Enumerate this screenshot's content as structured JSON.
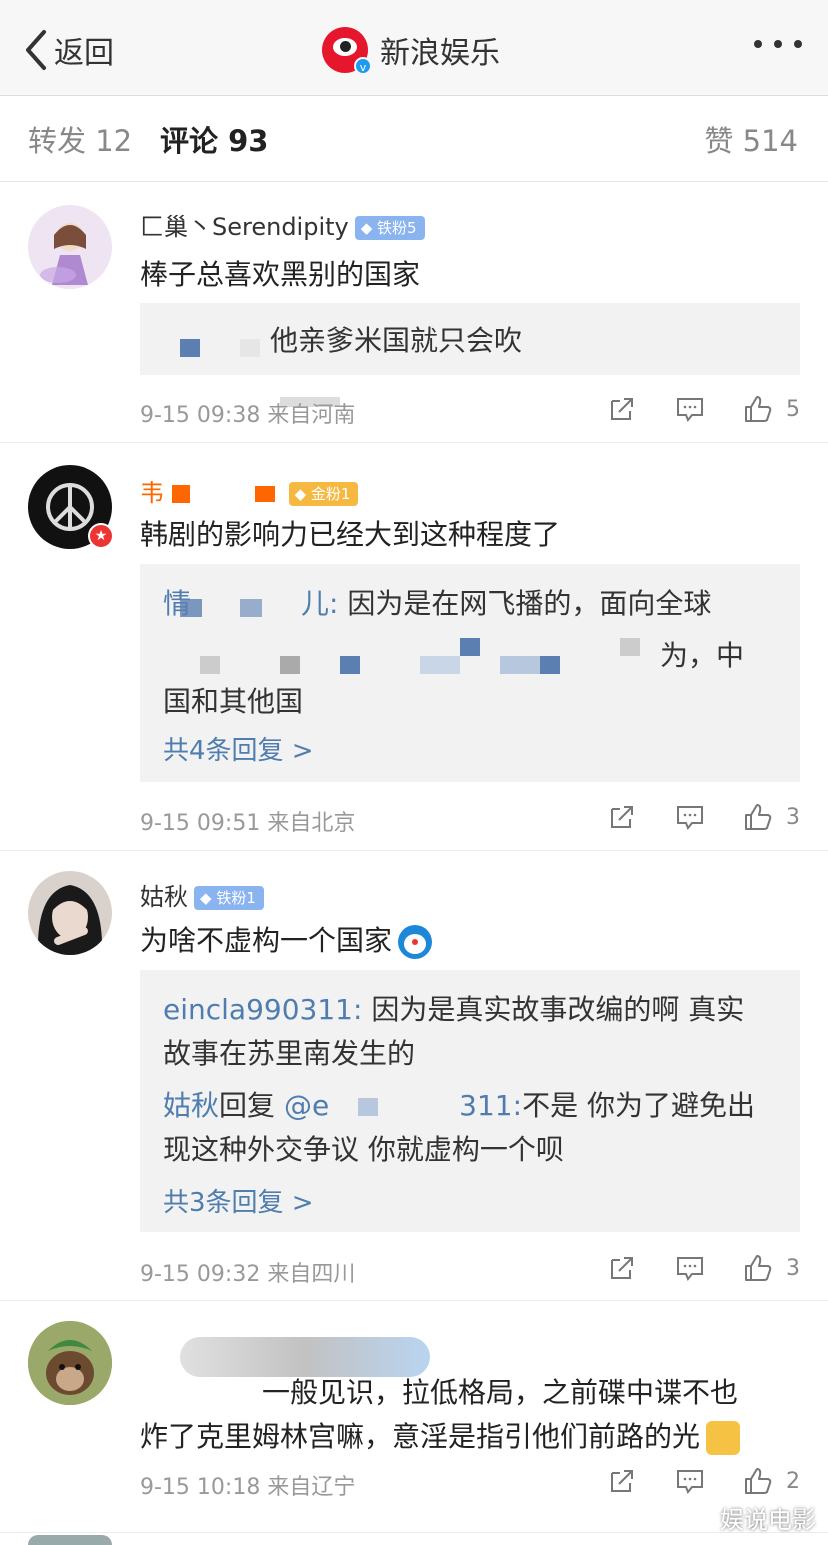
{
  "nav": {
    "back_label": "返回",
    "title": "新浪娱乐",
    "logo_text": "新浪娱乐"
  },
  "tabs": {
    "repost": "转发 12",
    "comments": "评论 93",
    "likes": "赞 514"
  },
  "comments": [
    {
      "username": "匚巢丶Serendipity",
      "badge": "铁粉5",
      "text": "棒子总喜欢黑别的国家",
      "replies": [
        "他亲爹米国就只会吹"
      ],
      "time": "9-15 09:38",
      "location": "来自河南",
      "likes": "5"
    },
    {
      "username": "韦",
      "badge": "金粉1",
      "text": "韩剧的影响力已经大到这种程度了",
      "replies": [
        {
          "name": "情",
          "name_tail": "儿:",
          "text": "因为是在网飞播的，面向全球"
        },
        {
          "text": "为，中"
        },
        {
          "text": "国和其他国"
        }
      ],
      "more": "共4条回复 >",
      "time": "9-15 09:51",
      "location": "来自北京",
      "likes": "3"
    },
    {
      "username": "姑秋",
      "badge": "铁粉1",
      "text": "为啥不虚构一个国家",
      "replies": [
        {
          "name": "eincla990311:",
          "text": "因为是真实故事改编的啊 真实"
        },
        {
          "text": "故事在苏里南发生的"
        },
        {
          "name": "姑秋",
          "mid": "回复",
          "at": "@e",
          "tail": "311:",
          "text": "不是 你为了避免出"
        },
        {
          "text": "现这种外交争议 你就虚构一个呗"
        }
      ],
      "more": "共3条回复 >",
      "time": "9-15 09:32",
      "location": "来自四川",
      "likes": "3"
    },
    {
      "text_line1": "一般见识，拉低格局，之前碟中谍不也",
      "text_line2": "炸了克里姆林宫嘛，意淫是指引他们前路的光",
      "time": "9-15 10:18",
      "location": "来自辽宁",
      "likes": "2"
    }
  ],
  "watermark": "娱说电影",
  "colors": {
    "link": "#507daf",
    "brand_red": "#e6162d",
    "iron_badge": "#8ab4f0",
    "gold_badge": "#f5b942"
  }
}
